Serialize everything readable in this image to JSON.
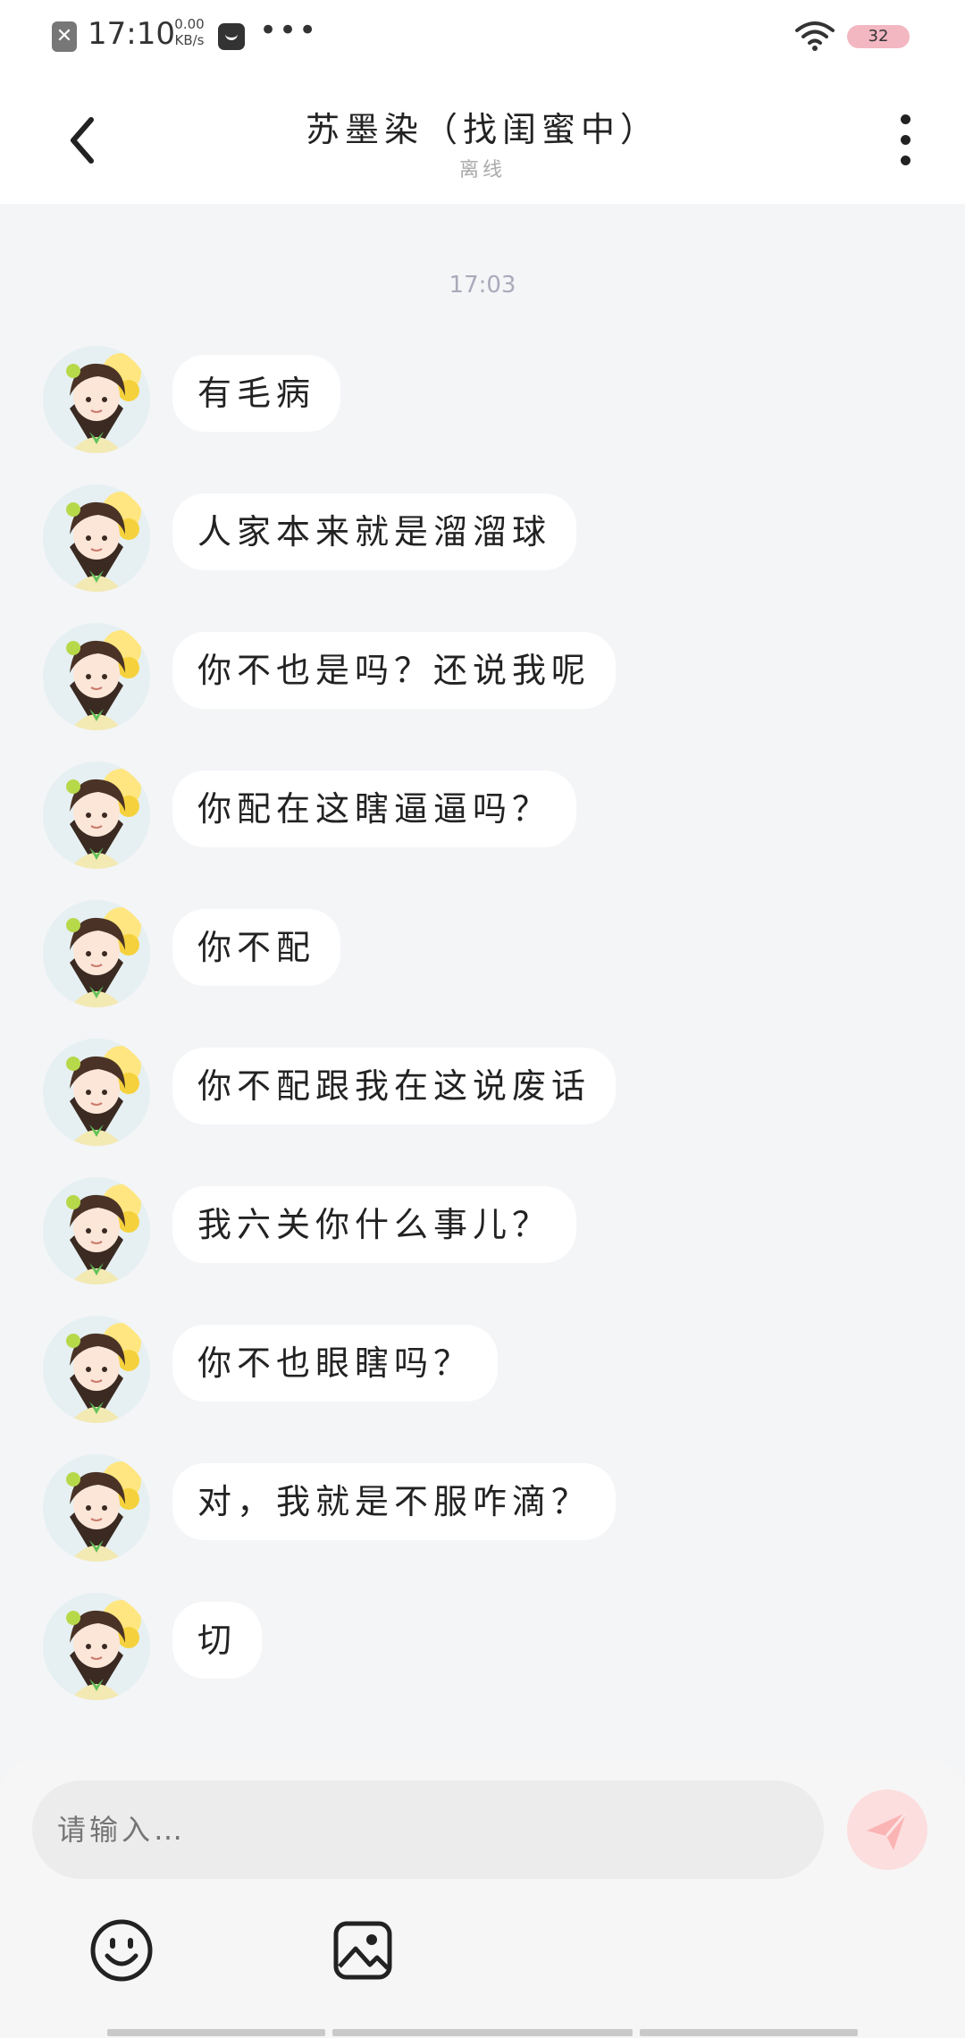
{
  "status_bar": {
    "close_glyph": "✕",
    "time": "17:10",
    "speed_value": "0.00",
    "speed_unit": "KB/s",
    "more_dots": "•••",
    "battery": "32"
  },
  "header": {
    "title": "苏墨染（找闺蜜中）",
    "status": "离线"
  },
  "chat": {
    "timestamp": "17:03",
    "messages": [
      {
        "text": "有毛病"
      },
      {
        "text": "人家本来就是溜溜球"
      },
      {
        "text": "你不也是吗？还说我呢"
      },
      {
        "text": "你配在这瞎逼逼吗？"
      },
      {
        "text": "你不配"
      },
      {
        "text": "你不配跟我在这说废话"
      },
      {
        "text": "我六关你什么事儿？"
      },
      {
        "text": "你不也眼瞎吗？"
      },
      {
        "text": "对，我就是不服咋滴？"
      },
      {
        "text": "切"
      }
    ]
  },
  "input": {
    "placeholder": "请输入…"
  },
  "icons": {
    "back": "chevron-left-icon",
    "more": "more-vertical-icon",
    "send": "send-icon",
    "emoji": "emoji-icon",
    "image": "image-icon"
  },
  "colors": {
    "background": "#f4f5f7",
    "bubble": "#ffffff",
    "send_button": "#fcdede"
  }
}
